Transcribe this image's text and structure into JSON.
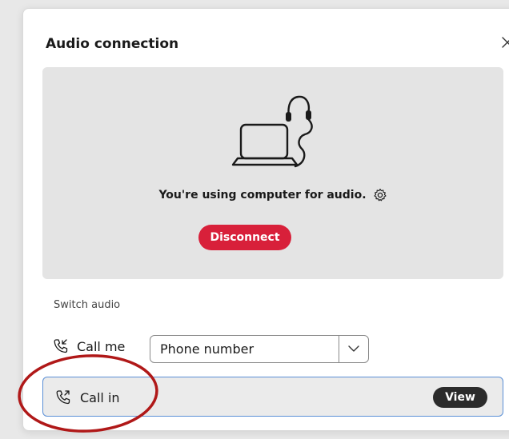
{
  "dialog": {
    "title": "Audio connection",
    "close_icon": "close-icon"
  },
  "audio_panel": {
    "illustration_icon": "laptop-headset-icon",
    "status_text": "You're using computer for audio.",
    "settings_icon": "gear-icon",
    "disconnect_label": "Disconnect",
    "disconnect_color": "#d8203a"
  },
  "switch_audio": {
    "label": "Switch audio",
    "call_me": {
      "icon": "phone-incoming-icon",
      "label": "Call me",
      "select_value": "Phone number",
      "chevron_icon": "chevron-down-icon"
    },
    "call_in": {
      "icon": "phone-outgoing-icon",
      "label": "Call in",
      "view_label": "View",
      "selected_border_color": "#5a8fd6"
    }
  },
  "annotation": {
    "color": "#b01818"
  }
}
